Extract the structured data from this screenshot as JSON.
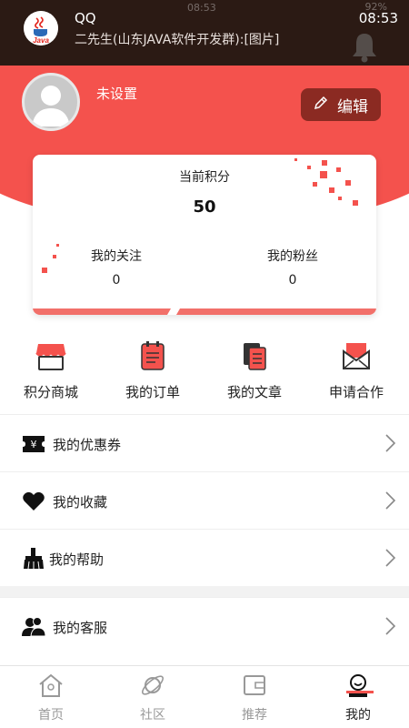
{
  "status_bar": {
    "time": "08:53",
    "battery": "92%"
  },
  "notification": {
    "app": "QQ",
    "message": "二先生(山东JAVA软件开发群):[图片]",
    "time": "08:53",
    "logo_text": "Java"
  },
  "profile": {
    "nickname": "未设置",
    "edit_label": "编辑"
  },
  "score_card": {
    "score_label": "当前积分",
    "score_value": "50",
    "following_label": "我的关注",
    "following_value": "0",
    "fans_label": "我的粉丝",
    "fans_value": "0"
  },
  "quick_menu": [
    {
      "label": "积分商城",
      "icon": "store-icon"
    },
    {
      "label": "我的订单",
      "icon": "order-icon"
    },
    {
      "label": "我的文章",
      "icon": "article-icon"
    },
    {
      "label": "申请合作",
      "icon": "mail-icon"
    }
  ],
  "menu_list": [
    {
      "label": "我的优惠券",
      "icon": "coupon-icon"
    },
    {
      "label": "我的收藏",
      "icon": "heart-icon"
    },
    {
      "label": "我的帮助",
      "icon": "broom-icon"
    },
    {
      "label": "我的客服",
      "icon": "customer-service-icon"
    }
  ],
  "tab_bar": [
    {
      "label": "首页",
      "icon": "home-icon"
    },
    {
      "label": "社区",
      "icon": "planet-icon"
    },
    {
      "label": "推荐",
      "icon": "wallet-icon"
    },
    {
      "label": "我的",
      "icon": "user-icon",
      "active": true
    }
  ],
  "colors": {
    "accent": "#f4524d",
    "edit_button": "#8b2a22",
    "notification_bg": "#2b1a14"
  }
}
